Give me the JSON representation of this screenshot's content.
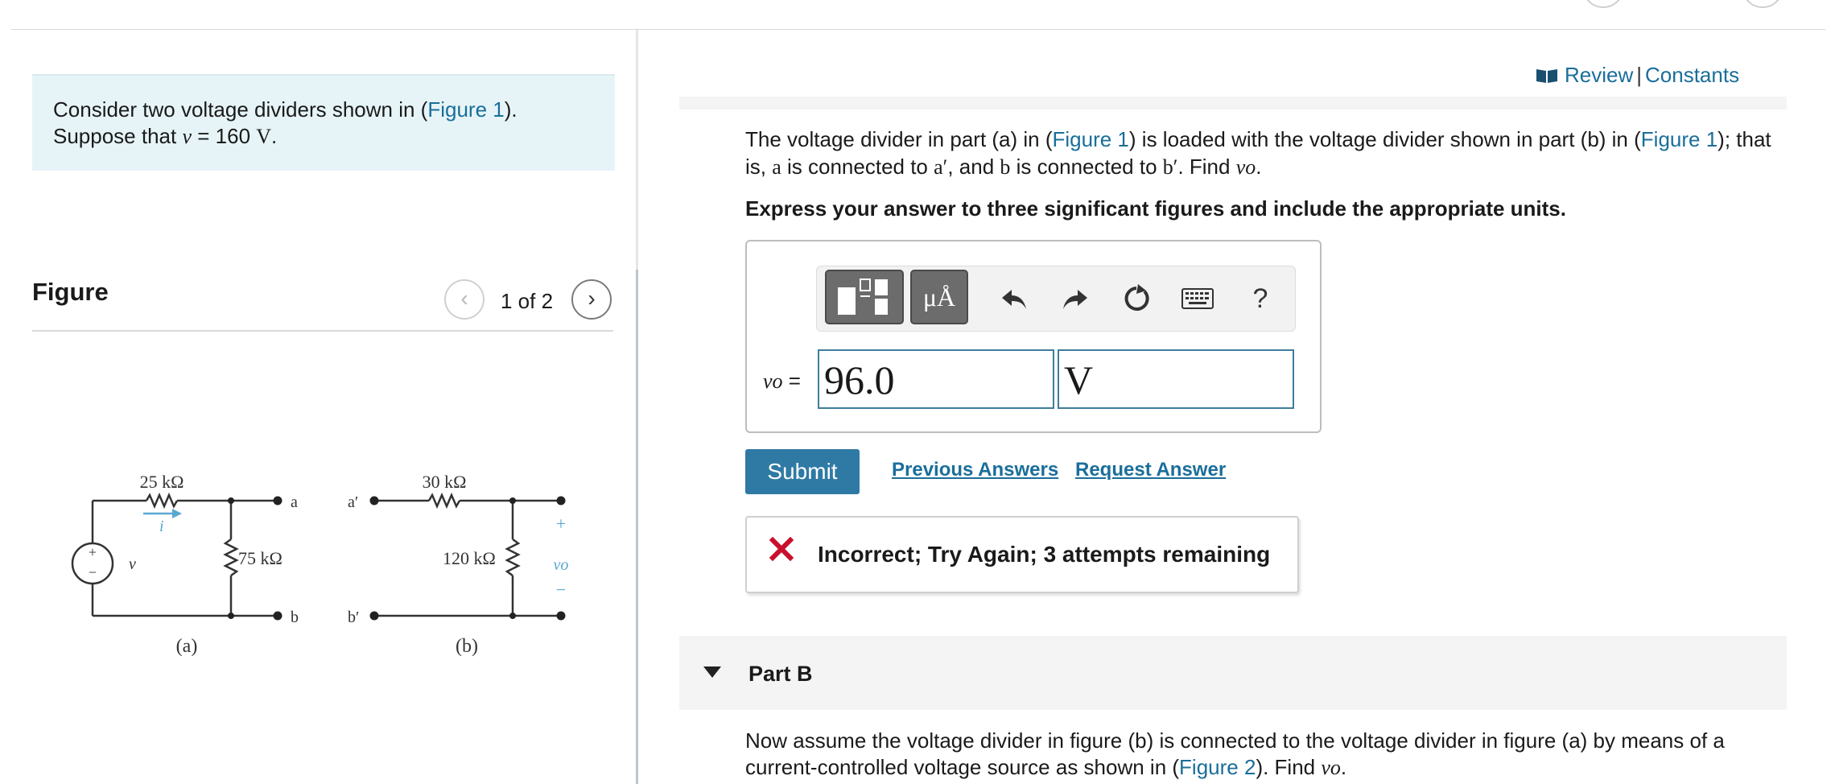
{
  "intro": {
    "line1_prefix": "Consider two voltage dividers shown in (",
    "figure_link": "Figure 1",
    "line1_suffix": ").",
    "line2_prefix": "Suppose that ",
    "var": "v",
    "equals": " = 160 ",
    "unit": "V",
    "period": "."
  },
  "figure": {
    "title": "Figure",
    "page": "1 of 2",
    "labels": {
      "r1": "25 kΩ",
      "r2": "75 kΩ",
      "r3": "30 kΩ",
      "r4": "120 kΩ",
      "node_a": "a",
      "node_b": "b",
      "node_a_prime": "a′",
      "node_b_prime": "b′",
      "source_var": "v",
      "current": "i",
      "vo": "vo",
      "plus": "+",
      "minus": "−",
      "caption_a": "(a)",
      "caption_b": "(b)"
    }
  },
  "links": {
    "review": "Review",
    "separator": "|",
    "constants": "Constants"
  },
  "question": {
    "t1": "The voltage divider in part (a) in (",
    "fig1": "Figure 1",
    "t2": ") is loaded with the voltage divider shown in part (b) in (",
    "fig1b": "Figure 1",
    "t3": "); that is, ",
    "a": "a",
    "t4": " is connected to ",
    "a_prime": "a′",
    "t5": ", and ",
    "b": "b",
    "t6": " is connected to ",
    "b_prime": "b′",
    "t7": ". Find ",
    "vo": "vo",
    "t8": "."
  },
  "instruction": "Express your answer to three significant figures and include the appropriate units.",
  "answer": {
    "var_label": "vo",
    "equals": " =",
    "value": "96.0",
    "unit": "V",
    "toolbar": {
      "units_label": "μÅ",
      "help": "?"
    }
  },
  "actions": {
    "submit": "Submit",
    "previous_answers": "Previous Answers",
    "request_answer": "Request Answer"
  },
  "feedback": {
    "text": "Incorrect; Try Again; 3 attempts remaining"
  },
  "part_b": {
    "title": "Part B",
    "t1": "Now assume the voltage divider in figure (b) is connected to the voltage divider in figure (a) by means of a current-controlled voltage source as shown in (",
    "fig2": "Figure 2",
    "t2": "). Find ",
    "vo": "vo",
    "t3": "."
  },
  "colors": {
    "link": "#1a6e9a",
    "submit_bg": "#2f7aa4",
    "intro_bg": "#e6f4f8",
    "error_red": "#c8102e",
    "field_border": "#3d7d9c"
  }
}
